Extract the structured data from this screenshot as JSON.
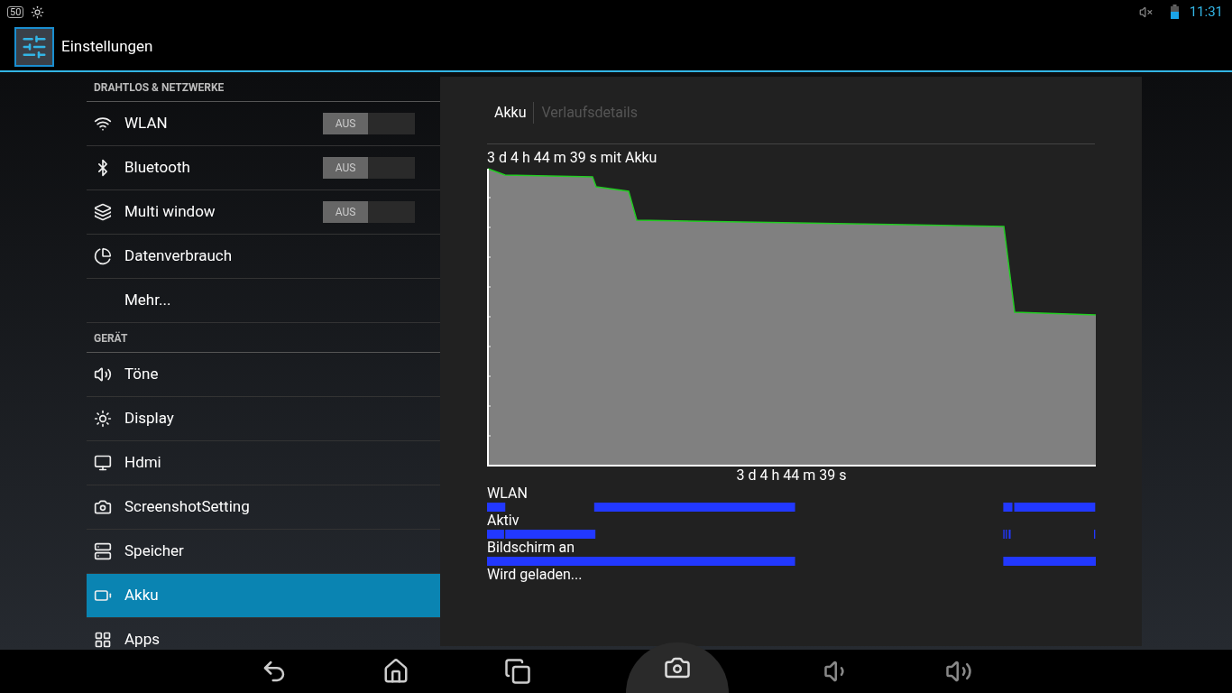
{
  "status_bar": {
    "badge": "50",
    "time": "11:31"
  },
  "action_bar": {
    "title": "Einstellungen"
  },
  "sidebar": {
    "sections": [
      {
        "header": "DRAHTLOS & NETZWERKE",
        "items": [
          {
            "label": "WLAN",
            "kind": "toggle",
            "on": false,
            "toggle_label": "AUS",
            "selected": false
          },
          {
            "label": "Bluetooth",
            "kind": "toggle",
            "on": false,
            "toggle_label": "AUS",
            "selected": false
          },
          {
            "label": "Multi window",
            "kind": "toggle",
            "on": false,
            "toggle_label": "AUS",
            "selected": false
          },
          {
            "label": "Datenverbrauch",
            "kind": "plain",
            "selected": false
          },
          {
            "label": "Mehr...",
            "kind": "plain",
            "selected": false
          }
        ]
      },
      {
        "header": "GERÄT",
        "items": [
          {
            "label": "Töne",
            "kind": "plain",
            "selected": false
          },
          {
            "label": "Display",
            "kind": "plain",
            "selected": false
          },
          {
            "label": "Hdmi",
            "kind": "plain",
            "selected": false
          },
          {
            "label": "ScreenshotSetting",
            "kind": "plain",
            "selected": false
          },
          {
            "label": "Speicher",
            "kind": "plain",
            "selected": false
          },
          {
            "label": "Akku",
            "kind": "plain",
            "selected": true
          },
          {
            "label": "Apps",
            "kind": "plain",
            "selected": false
          }
        ]
      }
    ]
  },
  "detail": {
    "tabs": [
      {
        "label": "Akku",
        "selected": true
      },
      {
        "label": "Verlaufsdetails",
        "selected": false
      }
    ],
    "duration_label": "3 d 4 h 44 m 39 s mit Akku",
    "axis_label": "3 d 4 h 44 m 39 s",
    "timelines": [
      {
        "label": "WLAN"
      },
      {
        "label": "Aktiv"
      },
      {
        "label": "Bildschirm an"
      },
      {
        "label": "Wird geladen..."
      }
    ]
  }
}
